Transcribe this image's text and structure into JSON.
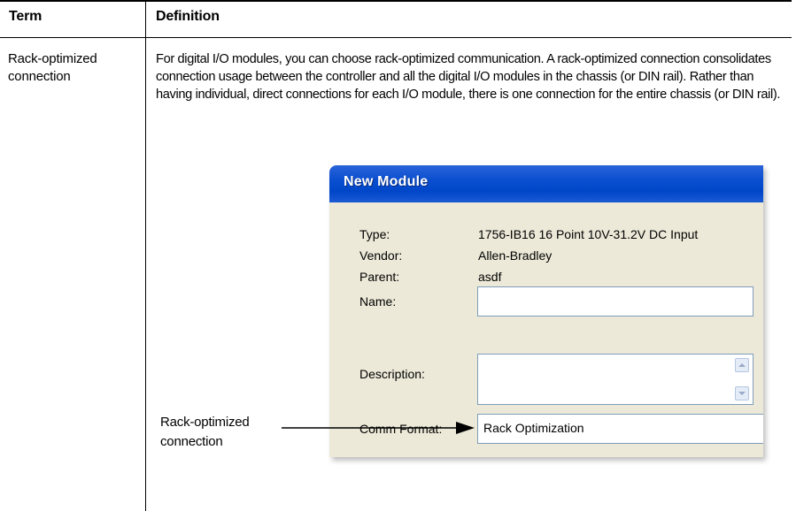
{
  "table": {
    "header_term": "Term",
    "header_definition": "Definition",
    "row_term": "Rack-optimized connection",
    "row_definition": "For digital I/O modules, you can choose rack-optimized communication. A rack-optimized connection consolidates connection usage between the controller and all the digital I/O modules in the chassis (or DIN rail). Rather than having individual, direct connections for each I/O module, there is one connection for the entire chassis (or DIN rail)."
  },
  "dialog": {
    "title": "New Module",
    "type_label": "Type:",
    "type_value": "1756-IB16 16 Point 10V-31.2V DC Input",
    "vendor_label": "Vendor:",
    "vendor_value": "Allen-Bradley",
    "parent_label": "Parent:",
    "parent_value": "asdf",
    "name_label": "Name:",
    "name_value": "",
    "description_label": "Description:",
    "description_value": "",
    "comm_format_label": "Comm Format:",
    "comm_format_value": "Rack Optimization",
    "icons": [
      "scroll-up-icon",
      "scroll-down-icon"
    ],
    "title_bar_color": "#0a4fd0",
    "face_color": "#ece9d8"
  },
  "callout": {
    "label": "Rack-optimized connection"
  }
}
